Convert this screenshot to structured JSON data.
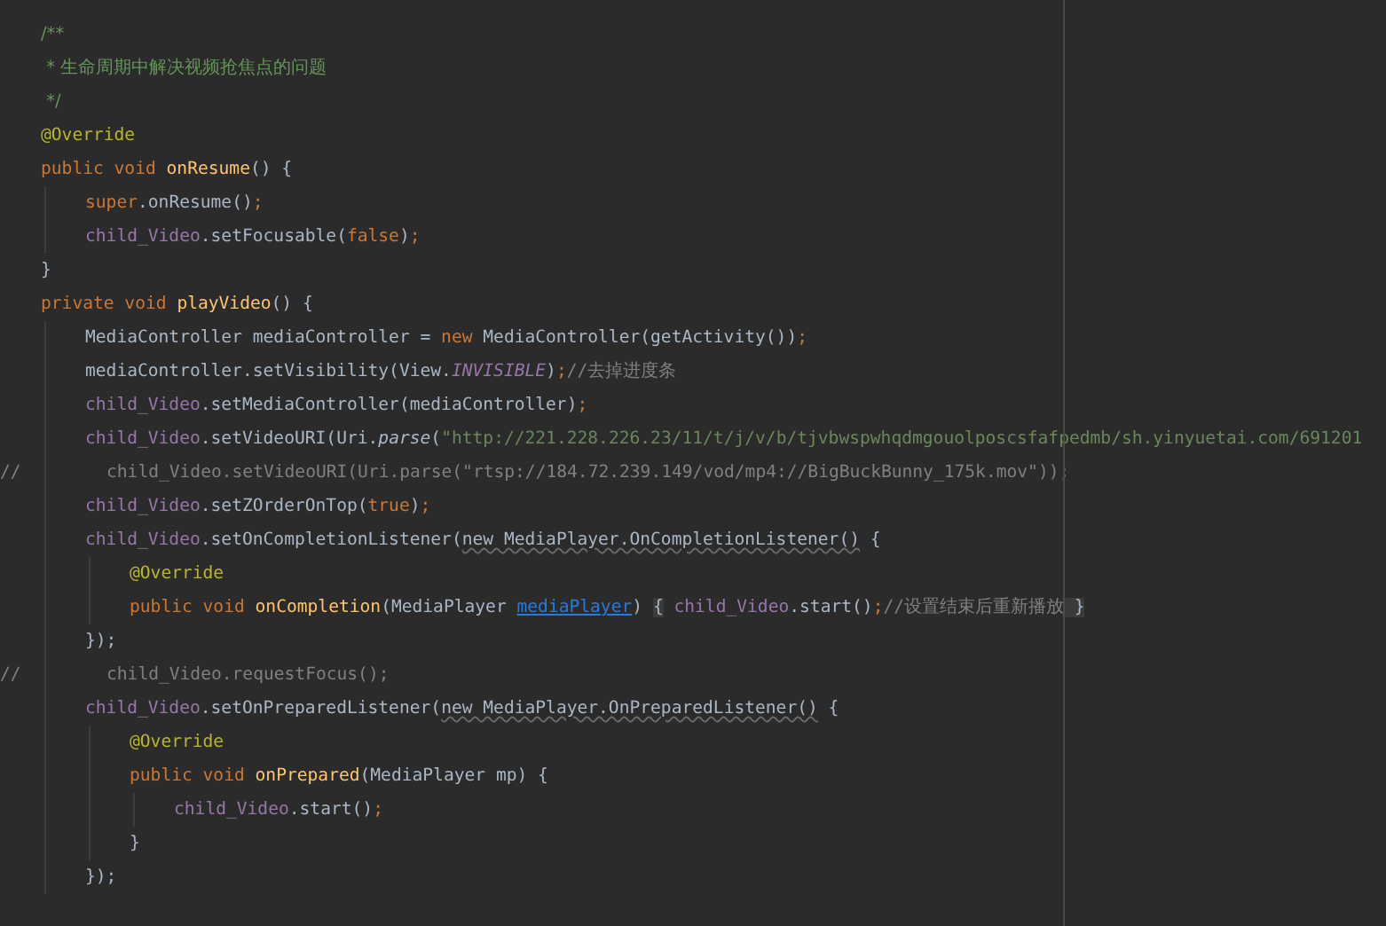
{
  "editor": {
    "lines": [
      {
        "tokens": [
          {
            "kind": "doc",
            "text": "/**"
          }
        ]
      },
      {
        "tokens": [
          {
            "kind": "doc",
            "text": " * 生命周期中解决视频抢焦点的问题"
          }
        ]
      },
      {
        "tokens": [
          {
            "kind": "doc",
            "text": " */"
          }
        ]
      },
      {
        "tokens": [
          {
            "kind": "annotation",
            "text": "@Override"
          }
        ]
      },
      {
        "tokens": [
          {
            "kind": "keyword",
            "text": "public void "
          },
          {
            "kind": "declaration",
            "text": "onResume"
          },
          {
            "kind": "plain",
            "text": "() {"
          }
        ],
        "children": [
          {
            "tokens": [
              {
                "kind": "keyword",
                "text": "super"
              },
              {
                "kind": "plain",
                "text": ".onResume()"
              },
              {
                "kind": "keyword",
                "text": ";"
              }
            ]
          },
          {
            "tokens": [
              {
                "kind": "field",
                "text": "child_Video"
              },
              {
                "kind": "plain",
                "text": ".setFocusable("
              },
              {
                "kind": "keyword",
                "text": "false"
              },
              {
                "kind": "plain",
                "text": ")"
              },
              {
                "kind": "keyword",
                "text": ";"
              }
            ]
          }
        ]
      },
      {
        "tokens": [
          {
            "kind": "plain",
            "text": "}"
          }
        ]
      },
      {
        "tokens": [
          {
            "kind": "keyword",
            "text": "private void "
          },
          {
            "kind": "declaration",
            "text": "playVideo"
          },
          {
            "kind": "plain",
            "text": "() {"
          }
        ],
        "children": [
          {
            "tokens": [
              {
                "kind": "plain",
                "text": "MediaController mediaController = "
              },
              {
                "kind": "keyword",
                "text": "new"
              },
              {
                "kind": "plain",
                "text": " MediaController(getActivity())"
              },
              {
                "kind": "keyword",
                "text": ";"
              }
            ]
          },
          {
            "tokens": [
              {
                "kind": "plain",
                "text": "mediaController.setVisibility(View."
              },
              {
                "kind": "constant",
                "text": "INVISIBLE"
              },
              {
                "kind": "plain",
                "text": ")"
              },
              {
                "kind": "keyword",
                "text": ";"
              },
              {
                "kind": "comment",
                "text": "//去掉进度条"
              }
            ]
          },
          {
            "tokens": [
              {
                "kind": "field",
                "text": "child_Video"
              },
              {
                "kind": "plain",
                "text": ".setMediaController(mediaController)"
              },
              {
                "kind": "keyword",
                "text": ";"
              }
            ]
          },
          {
            "tokens": [
              {
                "kind": "field",
                "text": "child_Video"
              },
              {
                "kind": "plain",
                "text": ".setVideoURI(Uri."
              },
              {
                "kind": "static-call",
                "text": "parse"
              },
              {
                "kind": "plain",
                "text": "("
              },
              {
                "kind": "string",
                "text": "\"http://221.228.226.23/11/t/j/v/b/tjvbwspwhqdmgouolposcsfafpedmb/sh.yinyuetai.com/691201"
              }
            ]
          },
          {
            "prefix": "//",
            "tokens": [
              {
                "kind": "comment",
                "text": "child_Video.setVideoURI(Uri.parse(\"rtsp://184.72.239.149/vod/mp4://BigBuckBunny_175k.mov\"));"
              }
            ]
          },
          {
            "tokens": [
              {
                "kind": "field",
                "text": "child_Video"
              },
              {
                "kind": "plain",
                "text": ".setZOrderOnTop("
              },
              {
                "kind": "keyword",
                "text": "true"
              },
              {
                "kind": "plain",
                "text": ")"
              },
              {
                "kind": "keyword",
                "text": ";"
              }
            ]
          },
          {
            "tokens": [
              {
                "kind": "field",
                "text": "child_Video"
              },
              {
                "kind": "plain",
                "text": ".setOnCompletionListener("
              },
              {
                "kind": "anonymous",
                "text": "new MediaPlayer.OnCompletionListener()"
              },
              {
                "kind": "plain",
                "text": " {"
              }
            ],
            "children": [
              {
                "tokens": [
                  {
                    "kind": "annotation",
                    "text": "@Override"
                  }
                ]
              },
              {
                "tokens": [
                  {
                    "kind": "keyword",
                    "text": "public void "
                  },
                  {
                    "kind": "declaration",
                    "text": "onCompletion"
                  },
                  {
                    "kind": "plain",
                    "text": "(MediaPlayer "
                  },
                  {
                    "kind": "parameter",
                    "text": "mediaPlayer"
                  },
                  {
                    "kind": "plain",
                    "text": ") "
                  },
                  {
                    "kind": "folded",
                    "text": "{"
                  },
                  {
                    "kind": "field",
                    "text": " child_Video"
                  },
                  {
                    "kind": "plain",
                    "text": ".start()"
                  },
                  {
                    "kind": "keyword",
                    "text": ";"
                  },
                  {
                    "kind": "comment",
                    "text": "//设置结束后重新播放"
                  },
                  {
                    "kind": "folded",
                    "text": " }"
                  }
                ]
              }
            ]
          },
          {
            "tokens": [
              {
                "kind": "plain",
                "text": "});"
              }
            ]
          },
          {
            "prefix": "//",
            "tokens": [
              {
                "kind": "comment",
                "text": "child_Video.requestFocus();"
              }
            ]
          },
          {
            "tokens": [
              {
                "kind": "field",
                "text": "child_Video"
              },
              {
                "kind": "plain",
                "text": ".setOnPreparedListener("
              },
              {
                "kind": "anonymous",
                "text": "new MediaPlayer.OnPreparedListener()"
              },
              {
                "kind": "plain",
                "text": " {"
              }
            ],
            "children": [
              {
                "tokens": [
                  {
                    "kind": "annotation",
                    "text": "@Override"
                  }
                ]
              },
              {
                "tokens": [
                  {
                    "kind": "keyword",
                    "text": "public void "
                  },
                  {
                    "kind": "declaration",
                    "text": "onPrepared"
                  },
                  {
                    "kind": "plain",
                    "text": "(MediaPlayer mp) {"
                  }
                ],
                "children": [
                  {
                    "tokens": [
                      {
                        "kind": "field",
                        "text": "child_Video"
                      },
                      {
                        "kind": "plain",
                        "text": ".start()"
                      },
                      {
                        "kind": "keyword",
                        "text": ";"
                      }
                    ]
                  }
                ]
              },
              {
                "tokens": [
                  {
                    "kind": "plain",
                    "text": "}"
                  }
                ]
              }
            ]
          },
          {
            "tokens": [
              {
                "kind": "plain",
                "text": "});"
              }
            ]
          }
        ]
      }
    ]
  }
}
